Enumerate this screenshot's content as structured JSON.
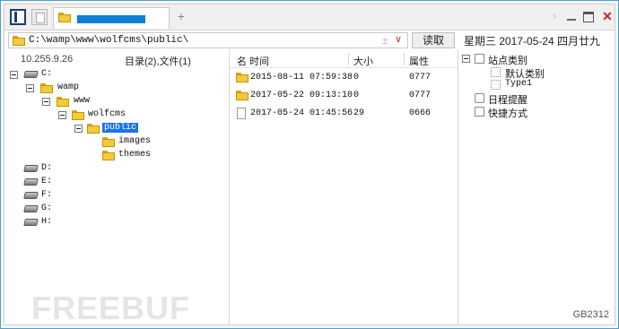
{
  "toolbar": {
    "tab_title": ""
  },
  "path": {
    "value": "C:\\wamp\\www\\wolfcms\\public\\",
    "read_label": "读取"
  },
  "date": "星期三 2017-05-24 四月廿九",
  "left_panel": {
    "ip": "10.255.9.26",
    "count": "目录(2),文件(1)",
    "tree": [
      {
        "label": "C:",
        "type": "drive",
        "expanded": true
      },
      {
        "label": "wamp",
        "type": "folder",
        "expanded": true
      },
      {
        "label": "www",
        "type": "folder",
        "expanded": true
      },
      {
        "label": "wolfcms",
        "type": "folder",
        "expanded": true
      },
      {
        "label": "public",
        "type": "folder",
        "expanded": true,
        "selected": true
      },
      {
        "label": "images",
        "type": "folder"
      },
      {
        "label": "themes",
        "type": "folder"
      },
      {
        "label": "D:",
        "type": "drive"
      },
      {
        "label": "E:",
        "type": "drive"
      },
      {
        "label": "F:",
        "type": "drive"
      },
      {
        "label": "G:",
        "type": "drive"
      },
      {
        "label": "H:",
        "type": "drive"
      }
    ]
  },
  "file_list": {
    "headers": {
      "name_time": "名 时间",
      "size": "大小",
      "attr": "属性"
    },
    "rows": [
      {
        "type": "folder",
        "time": "2015-08-11 07:59:38",
        "size": "0",
        "attr": "0777"
      },
      {
        "type": "folder",
        "time": "2017-05-22 09:13:10",
        "size": "0",
        "attr": "0777"
      },
      {
        "type": "file",
        "time": "2017-05-24 01:45:56",
        "size": "29",
        "attr": "0666"
      }
    ]
  },
  "right_panel": {
    "items": [
      {
        "label": "站点类别",
        "icon": "category-icon",
        "expanded": true
      },
      {
        "label": "默认类别",
        "icon": "category-item-icon"
      },
      {
        "label": "Type1",
        "icon": "category-item-icon"
      },
      {
        "label": "日程提醒",
        "icon": "schedule-icon"
      },
      {
        "label": "快捷方式",
        "icon": "shortcut-icon"
      }
    ]
  },
  "watermark": "FREEBUF",
  "footer": {
    "code": "GB2312"
  }
}
